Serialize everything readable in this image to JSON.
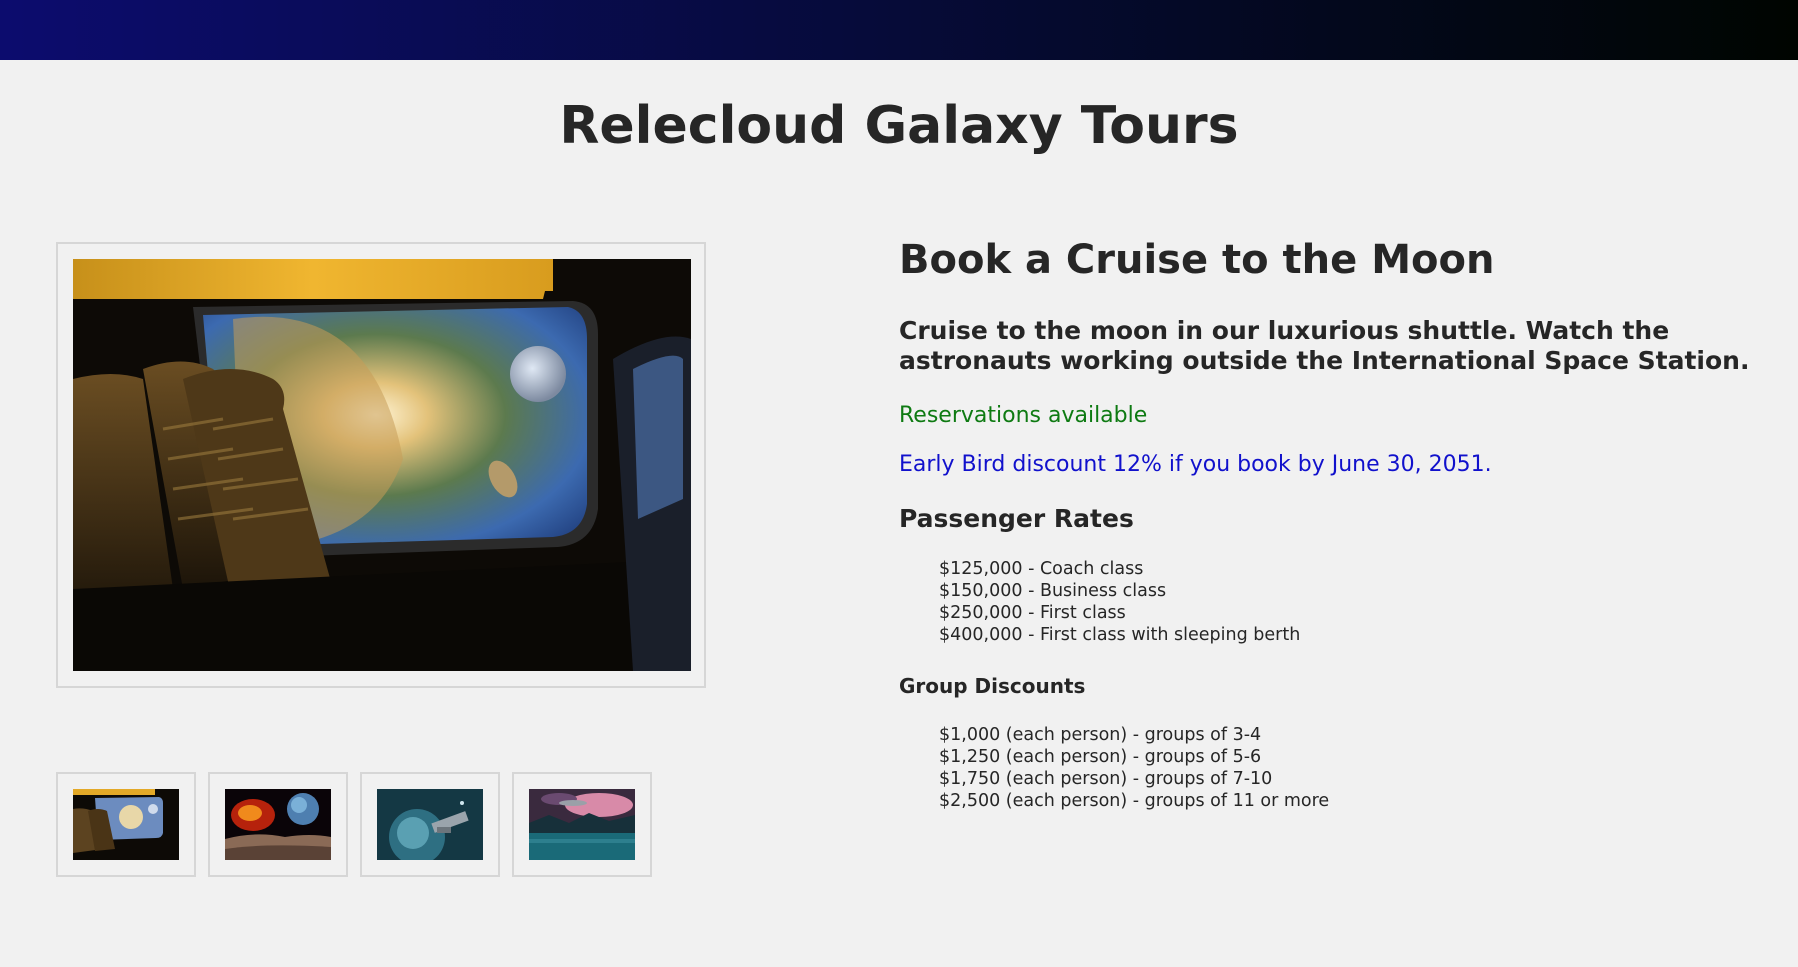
{
  "site": {
    "title": "Relecloud Galaxy Tours"
  },
  "gallery": {
    "main_image": "spaceship-window-astronaut-moon",
    "thumbnails": [
      "spaceship-window-thumbnail",
      "red-planet-surface-thumbnail",
      "blue-planet-station-thumbnail",
      "alien-lake-spaceship-thumbnail"
    ]
  },
  "tour": {
    "title": "Book a Cruise to the Moon",
    "description": "Cruise to the moon in our luxurious shuttle. Watch the astronauts working outside the International Space Station.",
    "availability": "Reservations available",
    "discount": "Early Bird discount 12% if you book by June 30, 2051."
  },
  "passenger_rates": {
    "heading": "Passenger Rates",
    "items": [
      "$125,000 - Coach class",
      "$150,000 - Business class",
      "$250,000 - First class",
      "$400,000 - First class with sleeping berth"
    ]
  },
  "group_discounts": {
    "heading": "Group Discounts",
    "items": [
      "$1,000 (each person) - groups of 3-4",
      "$1,250 (each person) - groups of 5-6",
      "$1,750 (each person) - groups of 7-10",
      "$2,500 (each person) - groups of 11 or more"
    ]
  },
  "colors": {
    "header_gradient_start": "#0c0c6e",
    "header_gradient_end": "#000500",
    "availability": "#0e7a12",
    "discount": "#1111cc",
    "text": "#262626",
    "background": "#f1f1f1"
  }
}
